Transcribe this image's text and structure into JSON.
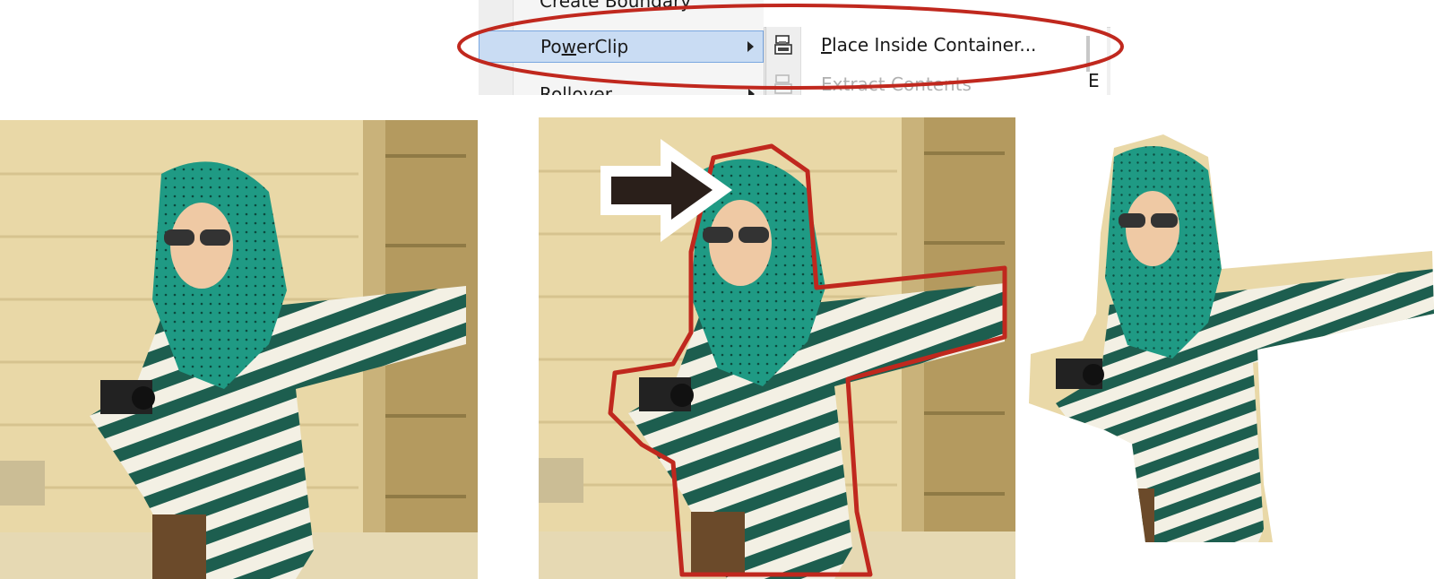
{
  "menu": {
    "items": [
      {
        "label": "Create Boundary"
      },
      {
        "label_prefix": "Po",
        "label_accel": "w",
        "label_suffix": "erClip"
      },
      {
        "label": "Rollover"
      }
    ],
    "submenu": {
      "items": [
        {
          "label_accel": "P",
          "label_suffix": "lace Inside Container..."
        },
        {
          "label": "Extract Contents"
        }
      ]
    },
    "clipped_char": "E"
  },
  "colors": {
    "highlight_ellipse": "#c0281e",
    "selection_bg": "#c9dcf3",
    "scarf_teal": "#1f9a84",
    "stripe_dark": "#1d5e4f",
    "stone_bg": "#e9d8a7"
  },
  "icons": [
    "create-boundary-icon",
    "place-inside-container-icon",
    "extract-contents-icon",
    "submenu-arrow-icon",
    "pointer-arrow-icon"
  ],
  "images": [
    {
      "name": "original-photo"
    },
    {
      "name": "traced-outline-photo"
    },
    {
      "name": "powerclip-result-photo"
    }
  ]
}
